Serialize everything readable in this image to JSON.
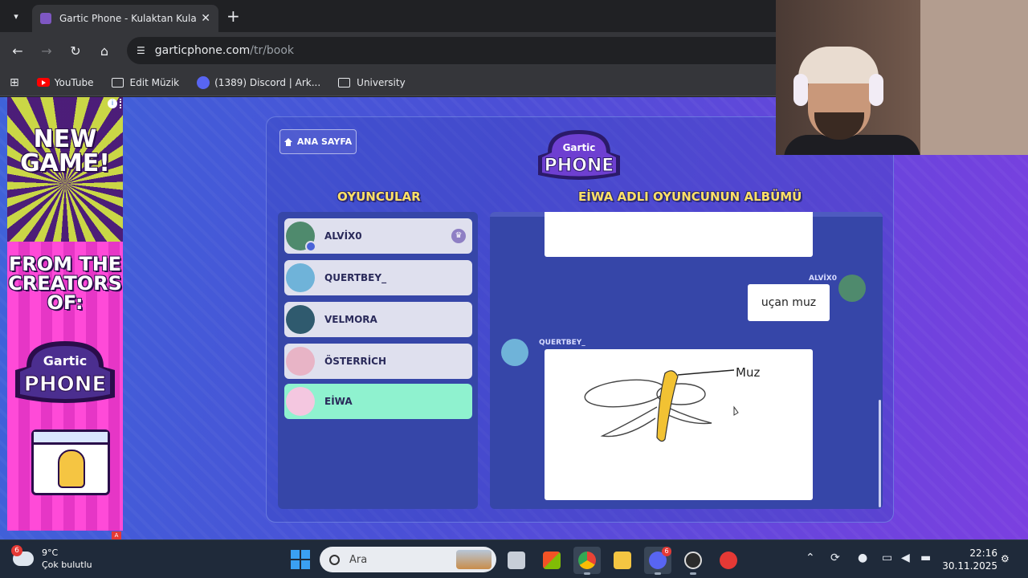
{
  "browser": {
    "tab_title": "Gartic Phone - Kulaktan Kulağa",
    "tab_close": "✕",
    "new_tab": "+",
    "url_host": "garticphone.com",
    "url_path": "/tr/book",
    "bookmarks": [
      {
        "label": "YouTube",
        "icon": "youtube-icon"
      },
      {
        "label": "Edit Müzik",
        "icon": "folder-icon"
      },
      {
        "label": "(1389) Discord | Ark...",
        "icon": "discord-icon"
      },
      {
        "label": "University",
        "icon": "folder-icon"
      }
    ]
  },
  "ad": {
    "headline": "NEW\nGAME!",
    "tagline": "FROM THE\nCREATORS\nOF:",
    "logo_top": "Gartic",
    "logo_bottom": "PHONE",
    "info": "i",
    "choice": "A"
  },
  "game": {
    "home_label": "ANA SAYFA",
    "logo_top": "Gartic",
    "logo_bottom": "PHONE",
    "players_title": "OYUNCULAR",
    "album_title": "EİWA ADLI OYUNCUNUN ALBÜMÜ",
    "crown": "♛",
    "players": [
      {
        "name": "ALVİX0",
        "color": "#4f8a6d",
        "active": false
      },
      {
        "name": "QUERTBEY_",
        "color": "#6fb3d9",
        "active": false
      },
      {
        "name": "VELMORA",
        "color": "#2f5a6e",
        "active": false
      },
      {
        "name": "ÖSTERRİCH",
        "color": "#e8b4c6",
        "active": false
      },
      {
        "name": "EİWA",
        "color": "#f4c7e0",
        "active": true
      }
    ],
    "album": {
      "message_author": "ALVİX0",
      "message_text": "uçan muz",
      "drawing_author": "QUERTBEY_",
      "drawing_label": "Muz"
    }
  },
  "taskbar": {
    "temperature": "9°C",
    "weather": "Çok bulutlu",
    "weather_badge": "6",
    "search_placeholder": "Ara",
    "discord_badge": "6",
    "time": "22:16",
    "date": "30.11.2025"
  }
}
